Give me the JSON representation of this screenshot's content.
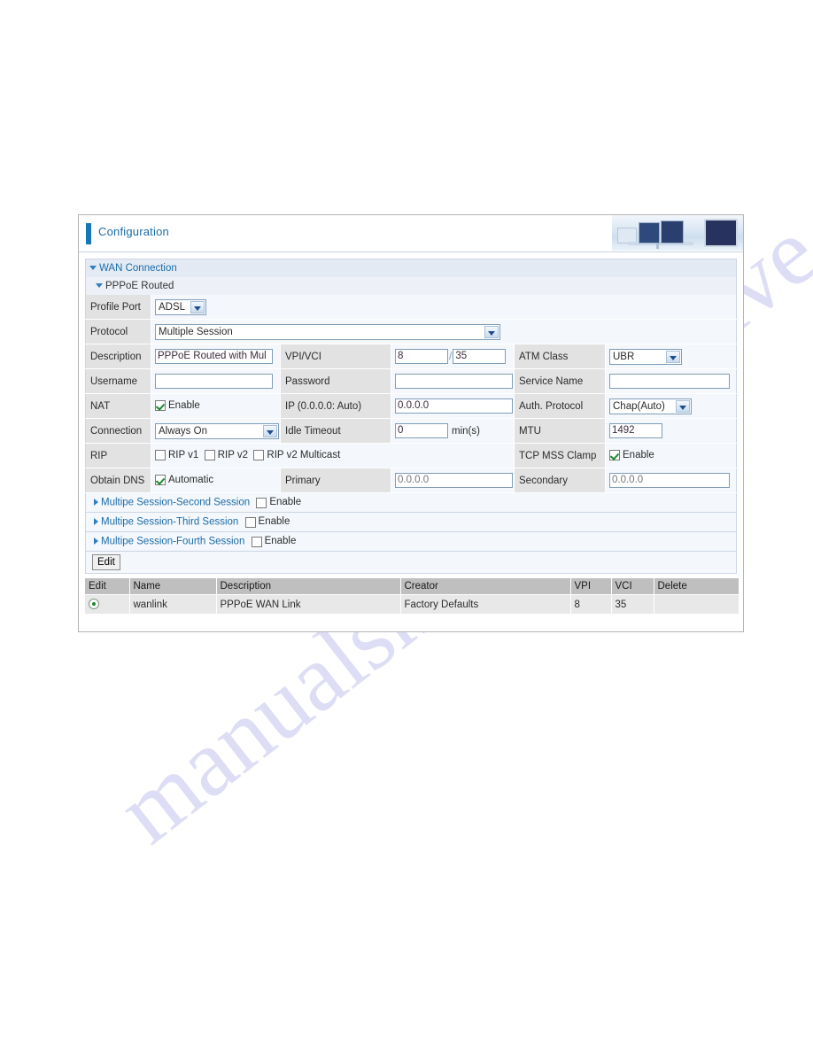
{
  "watermark": {
    "line1": "manualshive.com",
    "line2": "manualshive.com"
  },
  "header": {
    "title": "Configuration",
    "banner_icon": "office-computers-banner"
  },
  "sections": {
    "wan_connection": "WAN Connection",
    "pppoe_routed": "PPPoE Routed"
  },
  "form": {
    "profile_port": {
      "label": "Profile Port",
      "value": "ADSL"
    },
    "protocol": {
      "label": "Protocol",
      "value": "Multiple Session"
    },
    "description": {
      "label": "Description",
      "value": "PPPoE Routed with Mul"
    },
    "vpivci": {
      "label": "VPI/VCI",
      "vpi": "8",
      "vci": "35",
      "separator": "/"
    },
    "atm_class": {
      "label": "ATM Class",
      "value": "UBR"
    },
    "username": {
      "label": "Username",
      "value": ""
    },
    "password": {
      "label": "Password",
      "value": ""
    },
    "service_name": {
      "label": "Service Name",
      "value": ""
    },
    "nat": {
      "label": "NAT",
      "checkbox_label": "Enable",
      "checked": true
    },
    "ip": {
      "label": "IP (0.0.0.0: Auto)",
      "value": "0.0.0.0"
    },
    "auth_protocol": {
      "label": "Auth. Protocol",
      "value": "Chap(Auto)"
    },
    "connection": {
      "label": "Connection",
      "value": "Always On"
    },
    "idle_timeout": {
      "label": "Idle Timeout",
      "value": "0",
      "unit": "min(s)"
    },
    "mtu": {
      "label": "MTU",
      "value": "1492"
    },
    "rip": {
      "label": "RIP",
      "options": [
        {
          "label": "RIP v1",
          "checked": false
        },
        {
          "label": "RIP v2",
          "checked": false
        },
        {
          "label": "RIP v2 Multicast",
          "checked": false
        }
      ]
    },
    "tcp_mss_clamp": {
      "label": "TCP MSS Clamp",
      "checkbox_label": "Enable",
      "checked": true
    },
    "obtain_dns": {
      "label": "Obtain DNS",
      "checkbox_label": "Automatic",
      "checked": true
    },
    "primary_dns": {
      "label": "Primary",
      "placeholder": "0.0.0.0"
    },
    "secondary_dns": {
      "label": "Secondary",
      "placeholder": "0.0.0.0"
    }
  },
  "multi_sessions": [
    {
      "link": "Multipe Session-Second Session",
      "checkbox_label": "Enable",
      "checked": false
    },
    {
      "link": "Multipe Session-Third Session",
      "checkbox_label": "Enable",
      "checked": false
    },
    {
      "link": "Multipe Session-Fourth Session",
      "checkbox_label": "Enable",
      "checked": false
    }
  ],
  "edit_button": "Edit",
  "table": {
    "columns": [
      "Edit",
      "Name",
      "Description",
      "Creator",
      "VPI",
      "VCI",
      "Delete"
    ],
    "rows": [
      {
        "edit_selected": true,
        "name": "wanlink",
        "description": "PPPoE WAN Link",
        "creator": "Factory Defaults",
        "vpi": "8",
        "vci": "35",
        "delete": ""
      }
    ]
  }
}
